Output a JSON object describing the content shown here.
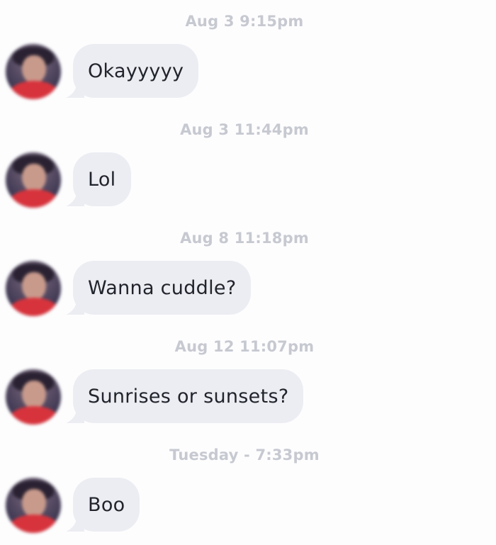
{
  "messages": [
    {
      "timestamp": "Aug 3 9:15pm",
      "text": "Okayyyyy"
    },
    {
      "timestamp": "Aug 3 11:44pm",
      "text": "Lol"
    },
    {
      "timestamp": "Aug 8 11:18pm",
      "text": "Wanna cuddle?"
    },
    {
      "timestamp": "Aug 12 11:07pm",
      "text": "Sunrises or sunsets?"
    },
    {
      "timestamp": "Tuesday - 7:33pm",
      "text": "Boo"
    }
  ],
  "colors": {
    "background": "#fdfdfe",
    "bubble": "#ecedf2",
    "timestamp_text": "#c7c9d1",
    "message_text": "#21242c"
  },
  "icons": {
    "avatar": "blurred-profile-photo"
  }
}
